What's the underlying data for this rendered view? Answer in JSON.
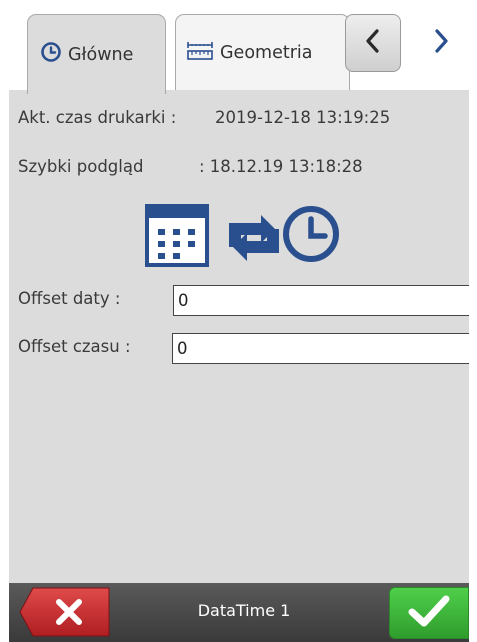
{
  "tabs": [
    {
      "label": "Główne",
      "icon": "clock-icon",
      "active": true
    },
    {
      "label": "Geometria",
      "icon": "ruler-icon",
      "active": false
    }
  ],
  "nav": {
    "prev_icon": "chevron-left-icon",
    "next_icon": "chevron-right-icon"
  },
  "info": {
    "printer_time_label": "Akt. czas drukarki :",
    "printer_time_value": "2019-12-18  13:19:25",
    "preview_label": "Szybki podgląd",
    "preview_value": ": 18.12.19 13:18:28"
  },
  "icons": [
    "calendar-icon",
    "sync-icon",
    "clock-icon"
  ],
  "fields": {
    "date_offset": {
      "label": "Offset daty   :",
      "value": "0"
    },
    "time_offset": {
      "label": "Offset czasu :",
      "value": "0"
    }
  },
  "footer": {
    "title": "DataTime 1",
    "cancel_icon": "close-icon",
    "ok_icon": "check-icon"
  },
  "colors": {
    "accent_blue": "#2a4f8f",
    "panel_gray": "#dcdcdc",
    "footer_dark": "#4a4a4a",
    "cancel_red": "#c8282c",
    "ok_green": "#3cb83a"
  }
}
